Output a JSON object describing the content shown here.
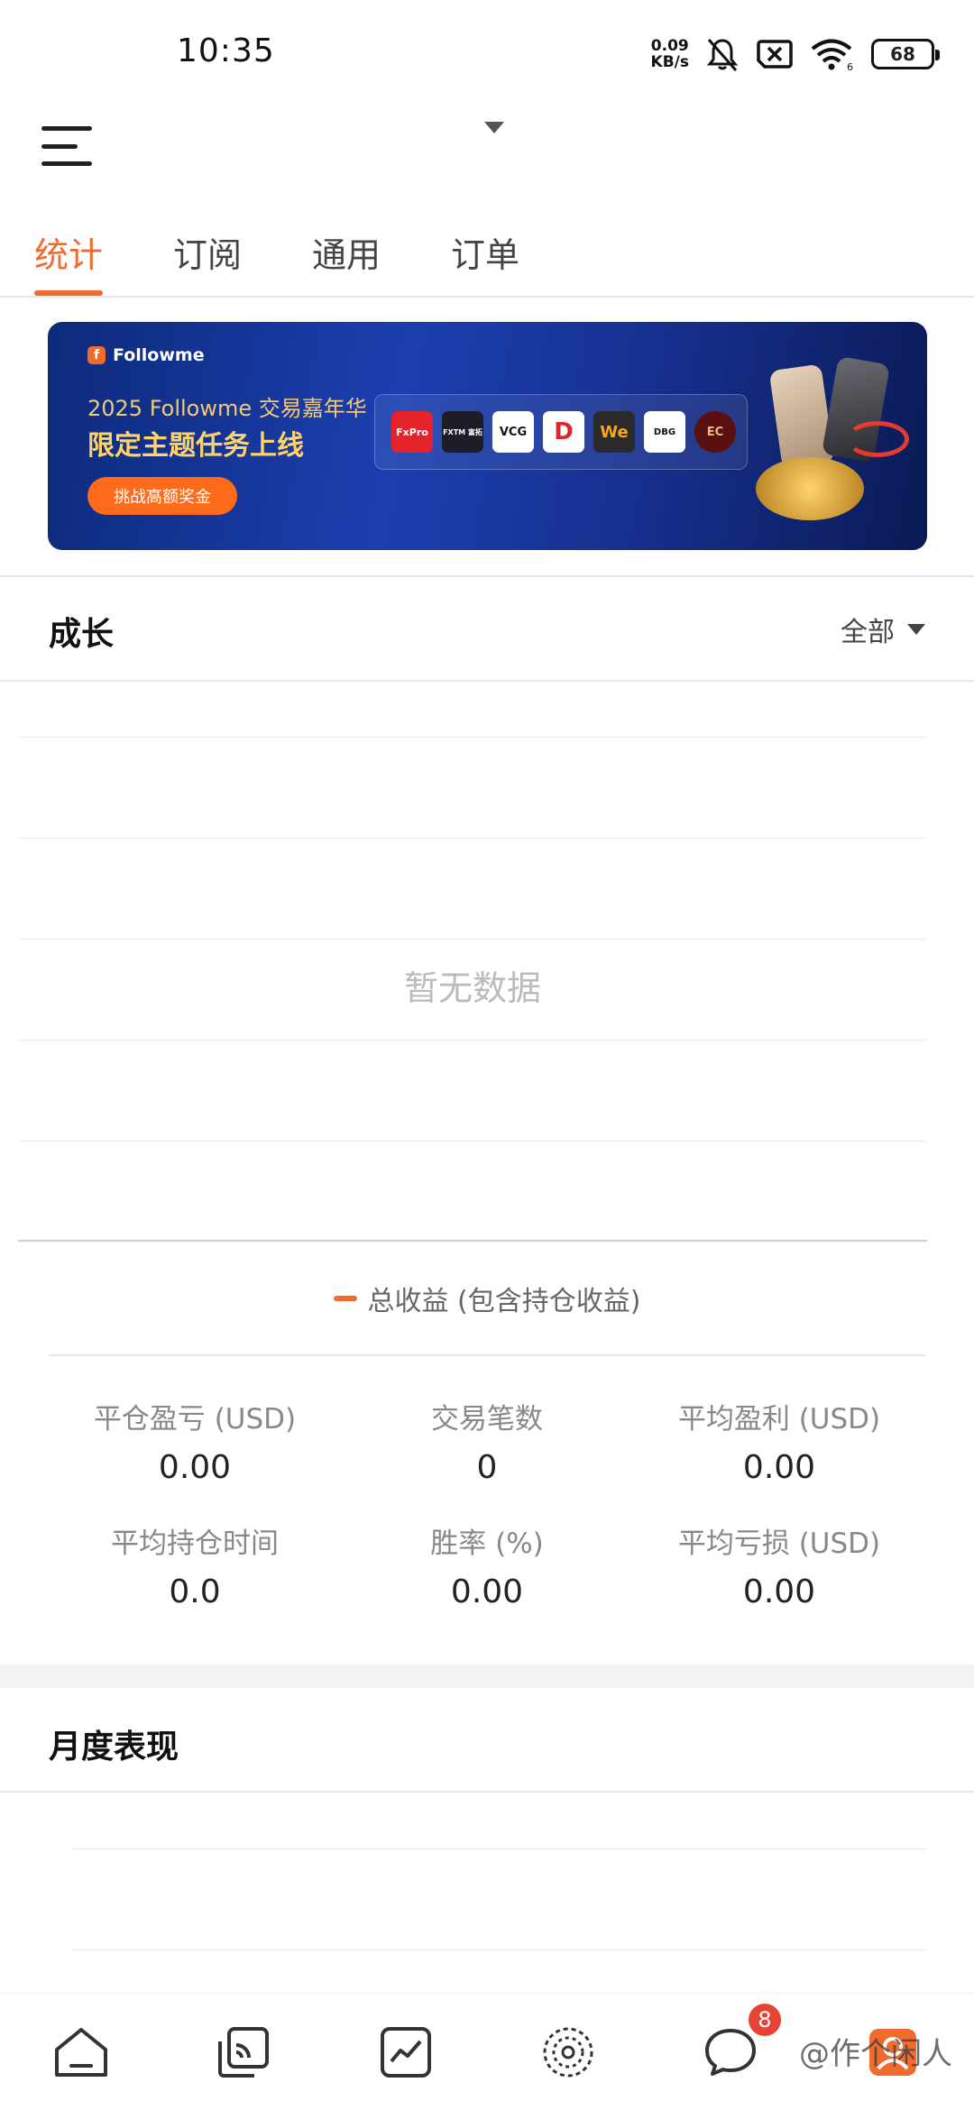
{
  "status_bar": {
    "time": "10:35",
    "net_speed_value": "0.09",
    "net_speed_unit": "KB/s",
    "battery": "68"
  },
  "tabs": [
    {
      "label": "统计",
      "active": true
    },
    {
      "label": "订阅",
      "active": false
    },
    {
      "label": "通用",
      "active": false
    },
    {
      "label": "订单",
      "active": false
    }
  ],
  "banner": {
    "brand": "Followme",
    "subtitle": "2025 Followme 交易嘉年华",
    "title": "限定主题任务上线",
    "cta": "挑战高额奖金",
    "brokers": [
      "FxPro",
      "FXTM 富拓",
      "VCG",
      "D",
      "We",
      "DBG",
      "EC"
    ]
  },
  "growth": {
    "title": "成长",
    "filter": "全部",
    "empty_text": "暂无数据",
    "legend": "总收益 (包含持仓收益)"
  },
  "stats": [
    {
      "label": "平仓盈亏 (USD)",
      "value": "0.00"
    },
    {
      "label": "交易笔数",
      "value": "0"
    },
    {
      "label": "平均盈利 (USD)",
      "value": "0.00"
    },
    {
      "label": "平均持仓时间",
      "value": "0.0"
    },
    {
      "label": "胜率 (%)",
      "value": "0.00"
    },
    {
      "label": "平均亏损 (USD)",
      "value": "0.00"
    }
  ],
  "monthly": {
    "title": "月度表现"
  },
  "bottom_nav": {
    "items": [
      {
        "icon": "home-icon"
      },
      {
        "icon": "signals-icon"
      },
      {
        "icon": "chart-icon"
      },
      {
        "icon": "explore-icon"
      },
      {
        "icon": "message-icon",
        "badge": "8"
      },
      {
        "icon": "profile-icon"
      }
    ]
  },
  "watermark": "@作个闲人",
  "colors": {
    "accent": "#f26b2e",
    "badge": "#e64334"
  }
}
